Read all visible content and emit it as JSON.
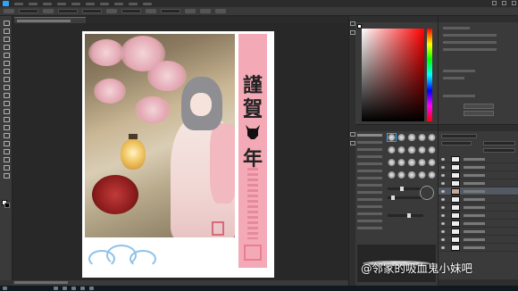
{
  "app": {
    "title": "",
    "active_tab": ""
  },
  "colors": {
    "accent": "#2fa3f7",
    "banner": "#f4a9b6",
    "workspace": "#282828"
  },
  "menubar": {
    "items": [
      "",
      "",
      "",
      "",
      "",
      "",
      "",
      "",
      "",
      "",
      ""
    ]
  },
  "toolbar": {
    "tools": [
      "move-icon",
      "marquee-icon",
      "lasso-icon",
      "quick-select-icon",
      "crop-icon",
      "eyedropper-icon",
      "healing-icon",
      "brush-icon",
      "stamp-icon",
      "history-brush-icon",
      "eraser-icon",
      "gradient-icon",
      "blur-icon",
      "dodge-icon",
      "pen-icon",
      "type-icon",
      "path-select-icon",
      "shape-icon",
      "hand-icon",
      "zoom-icon"
    ]
  },
  "artwork": {
    "calligraphy": [
      "謹",
      "賀",
      "年"
    ],
    "signature": ""
  },
  "status": {
    "zoom_text": ""
  },
  "layers": {
    "count": 12,
    "selected_index": 4
  },
  "watermark": {
    "text": "@邻家的吸血鬼小妹吧"
  }
}
